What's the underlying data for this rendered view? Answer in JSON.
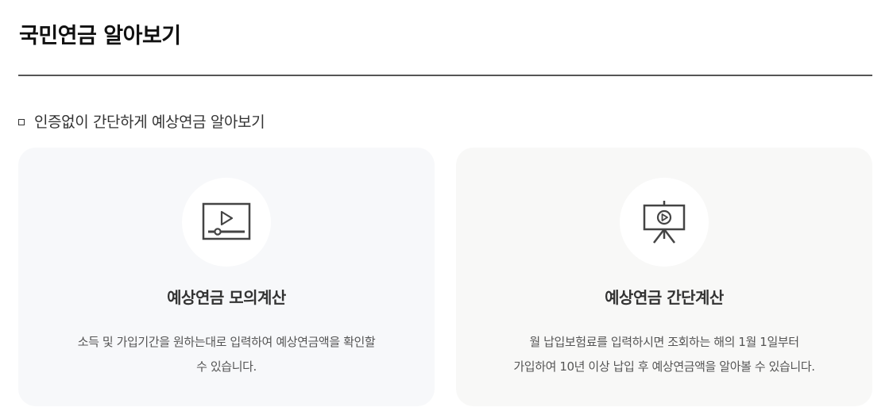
{
  "page": {
    "title": "국민연금 알아보기"
  },
  "section": {
    "heading": "인증없이 간단하게 예상연금 알아보기"
  },
  "cards": [
    {
      "icon": "video-player-icon",
      "title": "예상연금 모의계산",
      "desc_line1": "소득 및 가입기간을 원하는대로 입력하여 예상연금액을 확인할",
      "desc_line2": "수 있습니다."
    },
    {
      "icon": "presentation-easel-icon",
      "title": "예상연금 간단계산",
      "desc_line1": "월 납입보험료를 입력하시면 조회하는 해의 1월 1일부터",
      "desc_line2": "가입하여 10년 이상 납입 후 예상연금액을 알아볼 수 있습니다."
    }
  ],
  "colors": {
    "card1_bg": "#f7f8fa",
    "card2_bg": "#f8f8f7",
    "icon_stroke": "#444444",
    "rule": "#555555"
  }
}
